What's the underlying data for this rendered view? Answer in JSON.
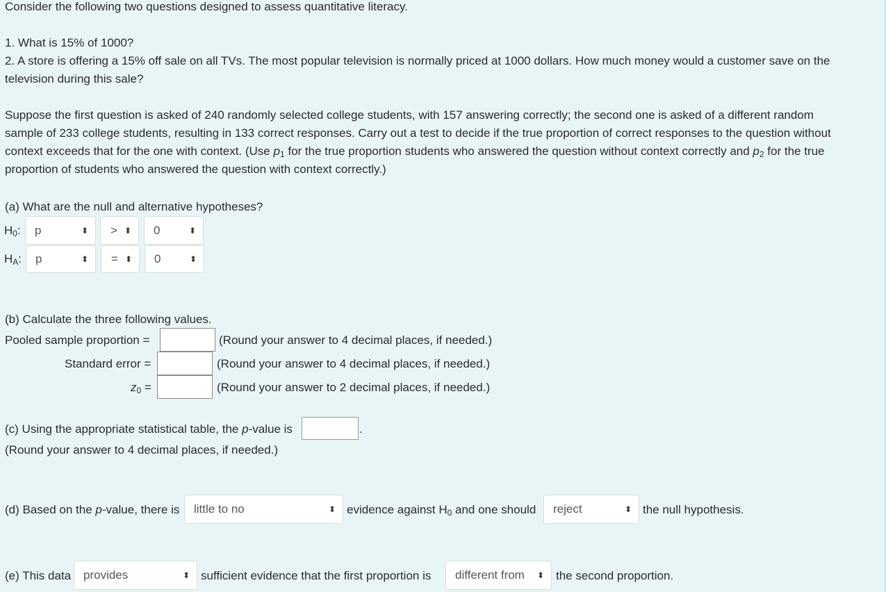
{
  "intro": "Consider the following two questions designed to assess quantitative literacy.",
  "questions": [
    "1. What is 15% of 1000?",
    "2. A store is offering a 15% off sale on all TVs. The most popular television is normally priced at 1000 dollars. How much money would a customer save on the",
    "television during this sale?"
  ],
  "scenario": {
    "line1": "Suppose the first question is asked of 240 randomly selected college students, with 157 answering correctly; the second one is asked of a different random",
    "line2": "sample of 233 college students, resulting in 133 correct responses. Carry out a test to decide if the true proportion of correct responses to the question without",
    "line3_a": "context exceeds that for the one with context. (Use ",
    "p1": "p",
    "p1_sub": "1",
    "line3_b": " for the true proportion students who answered the question without context correctly and ",
    "p2": "p",
    "p2_sub": "2",
    "line3_c": " for the true",
    "line4": "proportion of students who answered the question with context correctly.)"
  },
  "part_a": {
    "prompt": "(a) What are the null and alternative hypotheses?",
    "h0_label": "H",
    "h0_sub": "0",
    "ha_label": "H",
    "ha_sub": "A",
    "colon": ":",
    "h0": {
      "param": "p",
      "operator": ">",
      "value": "0"
    },
    "ha": {
      "param": "p",
      "operator": "=",
      "value": "0"
    },
    "arrow_glyph": "⬍"
  },
  "part_b": {
    "prompt": "(b) Calculate the three following values.",
    "pooled_label": "Pooled sample proportion =",
    "se_label": "Standard error =",
    "z_label_var": "z",
    "z_label_sub": "0",
    "z_label_eq": " =",
    "pooled_value": "",
    "se_value": "",
    "z_value": "",
    "round4": "(Round your answer to 4 decimal places, if needed.)",
    "round4b": "(Round your answer to 4 decimal places, if needed.)",
    "round2": "(Round your answer to 2 decimal places, if needed.)"
  },
  "part_c": {
    "prompt_a": "(c) Using the appropriate statistical table, the ",
    "p_italic": "p",
    "prompt_b": "-value is",
    "period": ".",
    "p_value": "",
    "round": "(Round your answer to 4 decimal places, if needed.)"
  },
  "part_d": {
    "text1_a": "(d) Based on the ",
    "text1_p": "p",
    "text1_b": "-value, there is",
    "evidence_select": "little to no",
    "text2_a": "evidence against H",
    "text2_sub": "0",
    "text2_b": " and one should",
    "decision_select": "reject",
    "text3": "the null hypothesis."
  },
  "part_e": {
    "text1": "(e) This data",
    "provides_select": "provides",
    "text2": "sufficient evidence that the first proportion is",
    "relation_select": "different from",
    "text3": "the second proportion."
  }
}
